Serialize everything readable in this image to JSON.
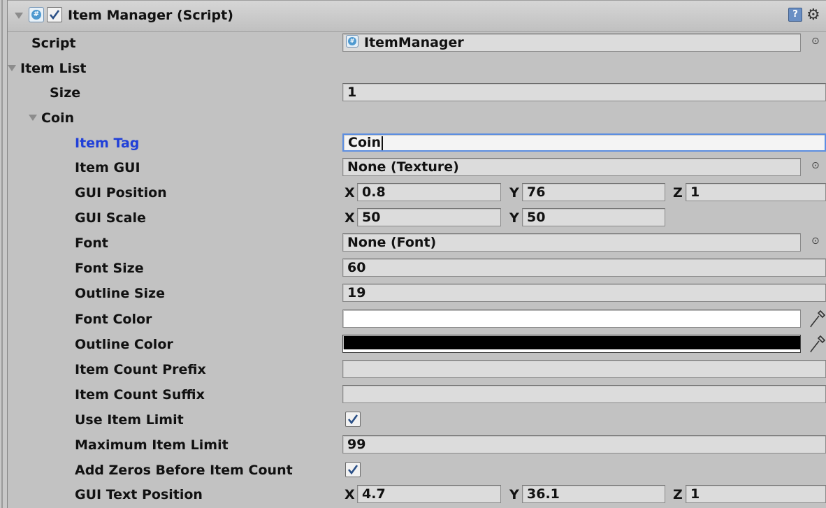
{
  "component": {
    "title": "Item Manager (Script)",
    "enabled": true
  },
  "fields": {
    "script": {
      "label": "Script",
      "value": "ItemManager"
    },
    "item_list": {
      "label": "Item List"
    },
    "size": {
      "label": "Size",
      "value": "1"
    },
    "element": {
      "label": "Coin"
    },
    "item_tag": {
      "label": "Item Tag",
      "value": "Coin"
    },
    "item_gui": {
      "label": "Item GUI",
      "value": "None (Texture)"
    },
    "gui_position": {
      "label": "GUI Position",
      "x_label": "X",
      "x": "0.8",
      "y_label": "Y",
      "y": "76",
      "z_label": "Z",
      "z": "1"
    },
    "gui_scale": {
      "label": "GUI Scale",
      "x_label": "X",
      "x": "50",
      "y_label": "Y",
      "y": "50"
    },
    "font": {
      "label": "Font",
      "value": "None (Font)"
    },
    "font_size": {
      "label": "Font Size",
      "value": "60"
    },
    "outline_size": {
      "label": "Outline Size",
      "value": "19"
    },
    "font_color": {
      "label": "Font Color",
      "color": "#ffffff"
    },
    "outline_color": {
      "label": "Outline Color",
      "color": "#000000"
    },
    "item_count_prefix": {
      "label": "Item Count Prefix",
      "value": ""
    },
    "item_count_suffix": {
      "label": "Item Count Suffix",
      "value": ""
    },
    "use_item_limit": {
      "label": "Use Item Limit",
      "checked": true
    },
    "maximum_item_limit": {
      "label": "Maximum Item Limit",
      "value": "99"
    },
    "add_zeros": {
      "label": "Add Zeros Before Item Count",
      "checked": true
    },
    "gui_text_position": {
      "label": "GUI Text Position",
      "x_label": "X",
      "x": "4.7",
      "y_label": "Y",
      "y": "36.1",
      "z_label": "Z",
      "z": "1"
    }
  },
  "colors": {
    "focus_label": "#2140d8",
    "panel": "#c2c2c2",
    "focus_border": "#5c8ee0"
  },
  "icons": [
    "foldout-arrow-icon",
    "csharp-script-icon",
    "help-book-icon",
    "gear-icon",
    "object-picker-icon",
    "eyedropper-icon",
    "checkmark-icon"
  ]
}
